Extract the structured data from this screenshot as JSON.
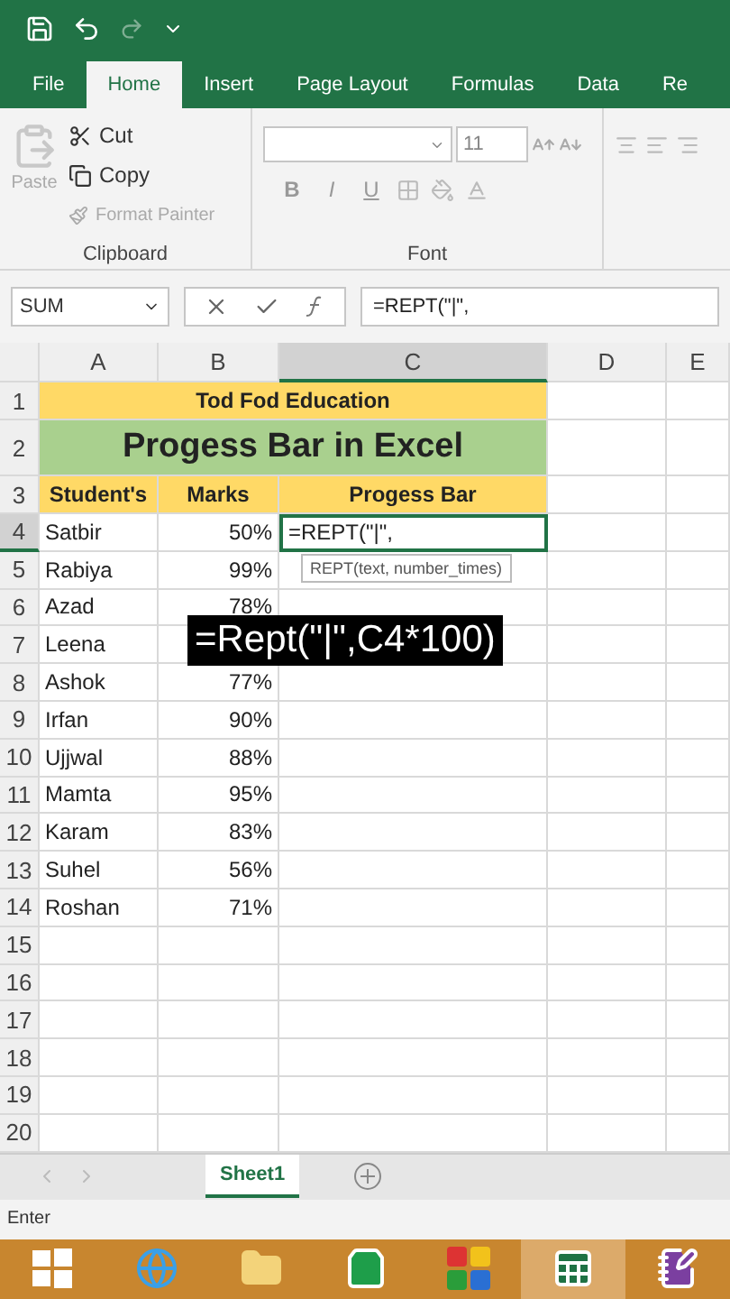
{
  "ribbon_tabs": [
    {
      "label": "File",
      "selected": false
    },
    {
      "label": "Home",
      "selected": true
    },
    {
      "label": "Insert",
      "selected": false
    },
    {
      "label": "Page Layout",
      "selected": false
    },
    {
      "label": "Formulas",
      "selected": false
    },
    {
      "label": "Data",
      "selected": false
    },
    {
      "label": "Re",
      "selected": false
    }
  ],
  "clipboard": {
    "paste": {
      "label": "Paste",
      "disabled": true
    },
    "cut": {
      "label": "Cut",
      "disabled": false
    },
    "copy": {
      "label": "Copy",
      "disabled": false
    },
    "format_painter": {
      "label": "Format Painter",
      "disabled": true
    },
    "group_label": "Clipboard"
  },
  "font": {
    "size": "11",
    "style_buttons": [
      "B",
      "I",
      "U"
    ],
    "group_label": "Font"
  },
  "formula_bar": {
    "name_box": "SUM",
    "formula": "=REPT(\"|\","
  },
  "columns": [
    "A",
    "B",
    "C",
    "D",
    "E"
  ],
  "title_row": {
    "number": "1",
    "text": "Tod Fod Education"
  },
  "heading_row": {
    "number": "2",
    "text": "Progess Bar in Excel"
  },
  "header_row": {
    "number": "3",
    "cells": [
      "Student's",
      "Marks",
      "Progess Bar"
    ]
  },
  "rows": [
    {
      "number": "4",
      "name": "Satbir",
      "marks": "50%",
      "progress": "=REPT(\"|\",",
      "active": true
    },
    {
      "number": "5",
      "name": "Rabiya",
      "marks": "99%",
      "active": false
    },
    {
      "number": "6",
      "name": "Azad",
      "marks": "78%",
      "active": false
    },
    {
      "number": "7",
      "name": "Leena",
      "active": false
    },
    {
      "number": "8",
      "name": "Ashok",
      "marks": "77%",
      "active": false
    },
    {
      "number": "9",
      "name": "Irfan",
      "marks": "90%",
      "active": false
    },
    {
      "number": "10",
      "name": "Ujjwal",
      "marks": "88%",
      "active": false
    },
    {
      "number": "11",
      "name": "Mamta",
      "marks": "95%",
      "active": false
    },
    {
      "number": "12",
      "name": "Karam",
      "marks": "83%",
      "active": false
    },
    {
      "number": "13",
      "name": "Suhel",
      "marks": "56%",
      "active": false
    },
    {
      "number": "14",
      "name": "Roshan",
      "marks": "71%",
      "active": false
    },
    {
      "number": "15",
      "active": false
    },
    {
      "number": "16",
      "active": false
    },
    {
      "number": "17",
      "active": false
    },
    {
      "number": "18",
      "active": false
    },
    {
      "number": "19",
      "active": false
    },
    {
      "number": "20",
      "active": false
    }
  ],
  "tooltip": "REPT(text, number_times)",
  "caption": "=Rept(\"|\",C4*100)",
  "sheet_tabs": [
    {
      "label": "Sheet1",
      "selected": true
    }
  ],
  "status_bar": "Enter",
  "taskbar": [
    {
      "kind": "windows",
      "active": false
    },
    {
      "kind": "browser",
      "active": false
    },
    {
      "kind": "folder",
      "active": false
    },
    {
      "kind": "store",
      "active": false
    },
    {
      "kind": "tiles",
      "active": false
    },
    {
      "kind": "excel",
      "active": true
    },
    {
      "kind": "notes",
      "active": false
    }
  ]
}
